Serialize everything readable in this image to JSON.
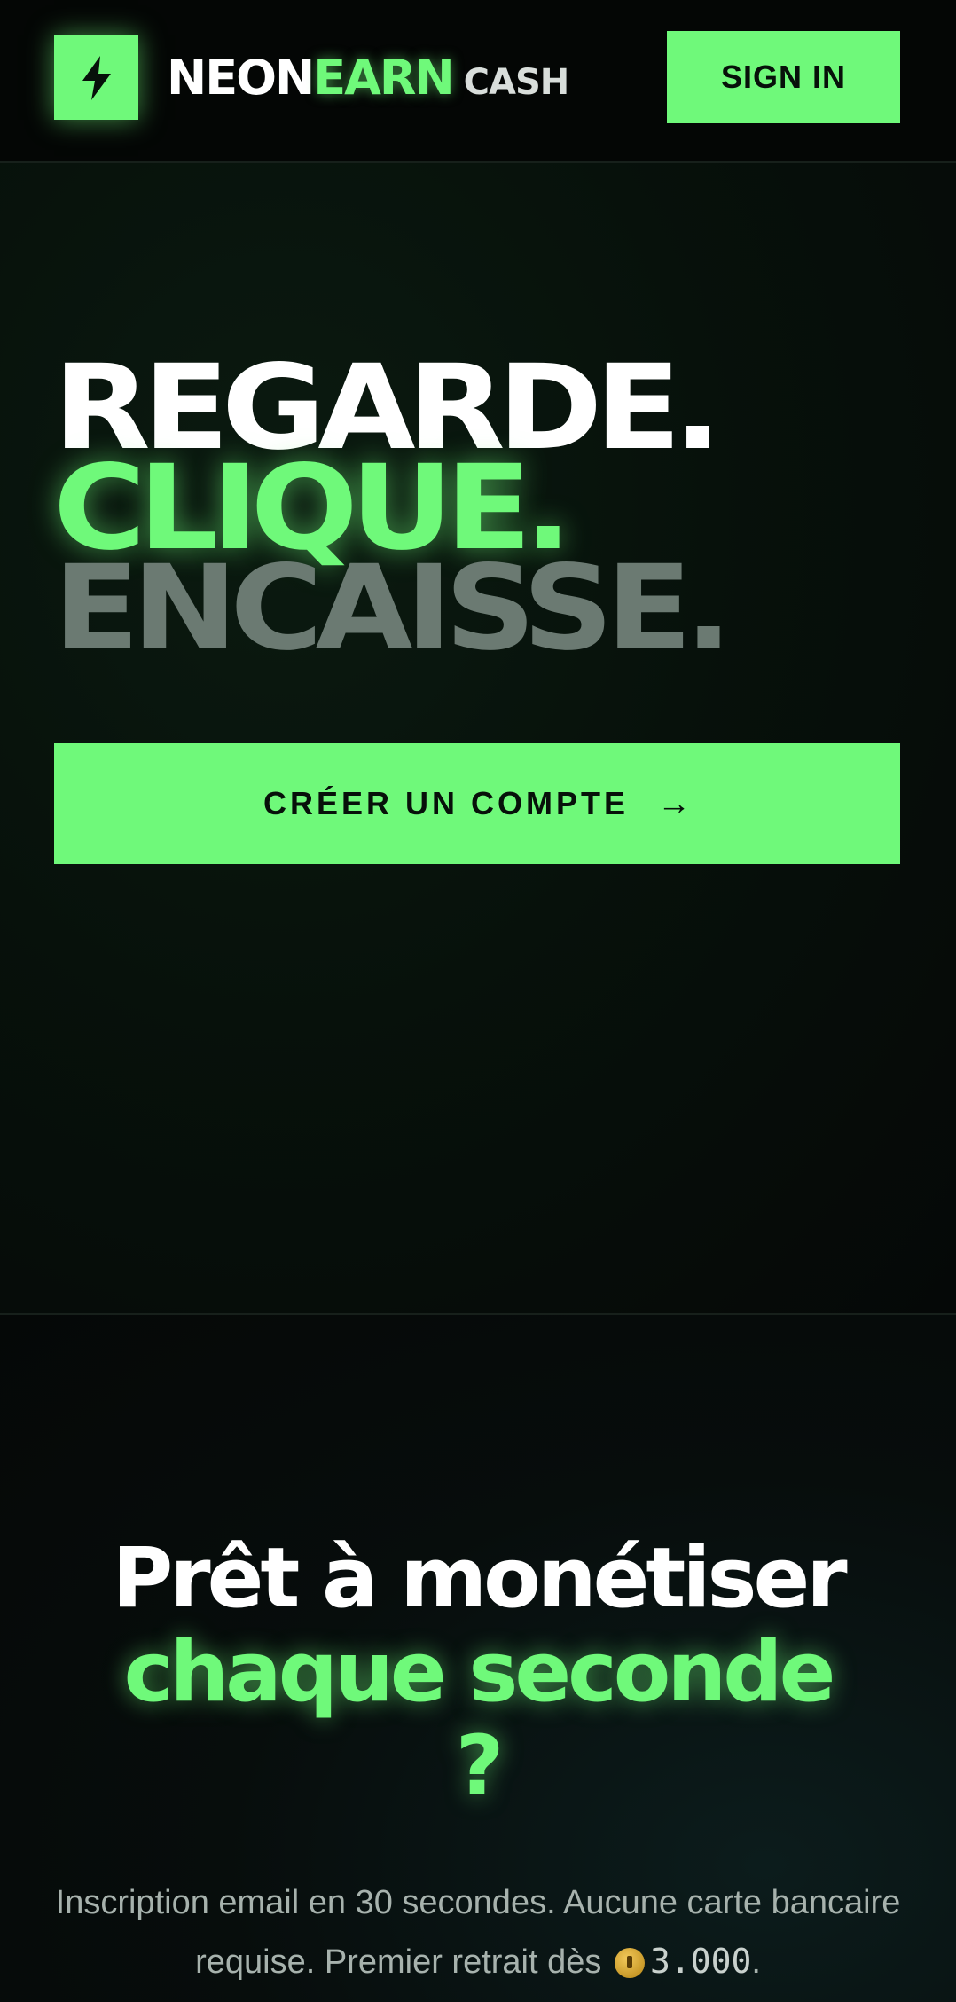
{
  "header": {
    "brand_part1": "NEON",
    "brand_part2": "EARN",
    "brand_part3": "CASH",
    "sign_in_label": "SIGN IN",
    "logo_icon": "lightning-bolt-icon"
  },
  "hero": {
    "line1": "REGARDE.",
    "line2": "CLIQUE.",
    "line3": "ENCAISSE.",
    "cta_label": "CRÉER UN COMPTE",
    "cta_icon": "arrow-right-icon"
  },
  "cta_section": {
    "title_line1": "Prêt à monétiser",
    "title_line2": "chaque seconde",
    "title_line3": "?",
    "subtitle_before_amount": "Inscription email en 30 secondes. Aucune carte bancaire requise. Premier retrait dès",
    "coin_icon": "coin-icon",
    "amount": "3.000",
    "subtitle_end": "."
  },
  "colors": {
    "accent": "#6ff97a",
    "background": "#050807",
    "muted_text": "#a7b2ad",
    "dim_heading": "#6b7a72"
  }
}
